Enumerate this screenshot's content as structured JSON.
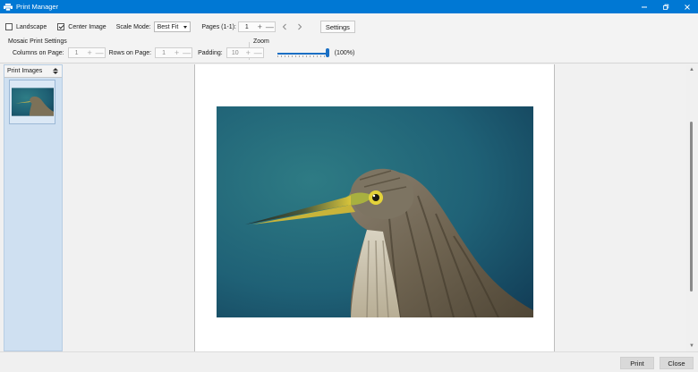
{
  "window": {
    "title": "Print Manager",
    "icon": "printer-icon",
    "controls": [
      "minimize-icon",
      "restore-icon",
      "close-icon"
    ]
  },
  "toolbar": {
    "landscape": {
      "label": "Landscape",
      "checked": false
    },
    "center_image": {
      "label": "Center Image",
      "checked": true
    },
    "scale_mode": {
      "label": "Scale Mode:",
      "value": "Best Fit"
    },
    "pages": {
      "label": "Pages (1-1):",
      "value": "1"
    },
    "settings_label": "Settings"
  },
  "mosaic": {
    "heading": "Mosaic Print Settings",
    "columns": {
      "label": "Columns on Page:",
      "value": "1"
    },
    "rows": {
      "label": "Rows on Page:",
      "value": "1"
    },
    "padding": {
      "label": "Padding:",
      "value": "10"
    }
  },
  "zoom": {
    "label": "Zoom",
    "value_text": "(100%)",
    "level": 1.0
  },
  "sidebar": {
    "header": "Print Images",
    "items": [
      {
        "name": "heron-photo-thumbnail"
      }
    ]
  },
  "colors": {
    "titlebar": "#0078d4",
    "accent": "#1a6fc4",
    "sidebar_bg": "#cfe0f1"
  },
  "footer": {
    "print_label": "Print",
    "close_label": "Close"
  }
}
